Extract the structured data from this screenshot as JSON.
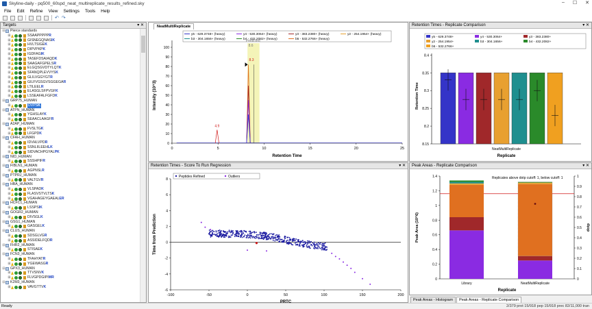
{
  "window": {
    "title": "Skyline-daily - pq500_60spd_neat_multireplicate_results_refined.sky",
    "min": "–",
    "max": "☐",
    "close": "✕"
  },
  "menu": [
    "File",
    "Edit",
    "Refine",
    "View",
    "Settings",
    "Tools",
    "Help"
  ],
  "targets": {
    "title": "Targets",
    "rows": [
      {
        "type": "protein",
        "name": "Pierce standards",
        "open": true
      },
      {
        "type": "pep",
        "seq": "SSAAPPPPP",
        "mod": "R"
      },
      {
        "type": "pep",
        "seq": "GISNEGQNAS",
        "mod": "IK"
      },
      {
        "type": "pep",
        "seq": "HVLTSIGE",
        "mod": "K"
      },
      {
        "type": "pep",
        "seq": "DIPVPKP",
        "mod": "K"
      },
      {
        "type": "pep",
        "seq": "IGDFAG",
        "mod": "IK"
      },
      {
        "type": "pep",
        "seq": "TASEFDSAIAQD",
        "mod": "K"
      },
      {
        "type": "pep",
        "seq": "SAAGAFGPELS",
        "mod": "R"
      },
      {
        "type": "pep",
        "seq": "ELGQSGVDTYLQT",
        "mod": "K"
      },
      {
        "type": "pep",
        "seq": "SFANQPLEVVYS",
        "mod": "K"
      },
      {
        "type": "pep",
        "seq": "GLILVGGYGT",
        "mod": "R"
      },
      {
        "type": "pep",
        "seq": "GILFVGSGVSGGEGA",
        "mod": "R"
      },
      {
        "type": "pep",
        "seq": "LTILEEL",
        "mod": "R"
      },
      {
        "type": "pep",
        "seq": "ELASGLSFPVGF",
        "mod": "K"
      },
      {
        "type": "pep",
        "seq": "LSSEAFALFGFD",
        "mod": "K"
      },
      {
        "type": "protein",
        "name": "GRP75_HUMAN",
        "open": true
      },
      {
        "type": "pep",
        "seq": "DVPS",
        "mod": "K",
        "sel": true
      },
      {
        "type": "protein",
        "name": "ATPN_HUMAN",
        "open": true
      },
      {
        "type": "pep",
        "seq": "YGHSLAY",
        "mod": "K"
      },
      {
        "type": "pep",
        "seq": "SEAACLAAGF",
        "mod": "R"
      },
      {
        "type": "protein",
        "name": "A2AP_HUMAN",
        "open": true
      },
      {
        "type": "pep",
        "seq": "FVSLTG",
        "mod": "K"
      },
      {
        "type": "pep",
        "seq": "LFGPD",
        "mod": "K"
      },
      {
        "type": "protein",
        "name": "CFAH_HUMAN",
        "open": true
      },
      {
        "type": "pep",
        "seq": "IDVHLVPD",
        "mod": "R"
      },
      {
        "type": "pep",
        "seq": "SSNLIILEEH",
        "mod": "LK"
      },
      {
        "type": "pep",
        "seq": "SIDVACHPGYAL",
        "mod": "PK"
      },
      {
        "type": "protein",
        "name": "NID_HUMAN",
        "open": true
      },
      {
        "type": "pep",
        "seq": "SSSHPIF",
        "mod": "R"
      },
      {
        "type": "protein",
        "name": "FIBLN1_HUMAN",
        "open": true
      },
      {
        "type": "pep",
        "seq": "AGPNSL",
        "mod": "R"
      },
      {
        "type": "protein",
        "name": "PTPRJ_HUMAN",
        "open": true
      },
      {
        "type": "pep",
        "seq": "VALTGV",
        "mod": "R"
      },
      {
        "type": "protein",
        "name": "HBA_HUMAN",
        "open": true
      },
      {
        "type": "pep",
        "seq": "VLSPAD",
        "mod": "K"
      },
      {
        "type": "pep",
        "seq": "FLASVSTVLTS",
        "mod": "K"
      },
      {
        "type": "pep",
        "seq": "VGAHAGEYGAEAL",
        "mod": "ER"
      },
      {
        "type": "protein",
        "name": "HCFC1_HUMAN",
        "open": true
      },
      {
        "type": "pep",
        "seq": "LSSPS",
        "mod": "IK"
      },
      {
        "type": "protein",
        "name": "GOGR2_HUMAN",
        "open": true
      },
      {
        "type": "pep",
        "seq": "DIVSGL",
        "mod": "K"
      },
      {
        "type": "protein",
        "name": "GSG1_HUMAN",
        "open": true
      },
      {
        "type": "pep",
        "seq": "GASGEL",
        "mod": "K"
      },
      {
        "type": "protein",
        "name": "CLUS_HUMAN",
        "open": true
      },
      {
        "type": "pep",
        "seq": "SDSGLVG",
        "mod": "R"
      },
      {
        "type": "pep",
        "seq": "ASSIDELFQD",
        "mod": "R"
      },
      {
        "type": "protein",
        "name": "FHR2_HUMAN",
        "open": true
      },
      {
        "type": "pep",
        "seq": "STISAE",
        "mod": "K"
      },
      {
        "type": "protein",
        "name": "FCN3_HUMAN",
        "open": true
      },
      {
        "type": "pep",
        "seq": "TFAHYAT",
        "mod": "R"
      },
      {
        "type": "pep",
        "seq": "YGEWASG",
        "mod": "R"
      },
      {
        "type": "protein",
        "name": "GPX3_HUMAN",
        "open": true
      },
      {
        "type": "pep",
        "seq": "TTVSNV",
        "mod": "K"
      },
      {
        "type": "pep",
        "seq": "FLVGPDGIPI",
        "mod": "MR"
      },
      {
        "type": "protein",
        "name": "K2M3_HUMAN",
        "open": true
      },
      {
        "type": "pep",
        "seq": "VAVGTTV",
        "mod": "K"
      }
    ]
  },
  "chromatogram": {
    "tab": "NeatMultiReplicate",
    "legend": [
      {
        "label": "y5 - 629.3748+ (heavy)",
        "color": "#3434c8"
      },
      {
        "label": "y4 - 530.3064+ (heavy)",
        "color": "#8a2be2"
      },
      {
        "label": "y3 - 383.2380+ (heavy)",
        "color": "#a0282a"
      },
      {
        "label": "y2 - 254.1954+ (heavy)",
        "color": "#e8a030"
      },
      {
        "label": "b3 - 304.1656+ (heavy)",
        "color": "#1f8f8f"
      },
      {
        "label": "b4 - 432.2082+ (heavy)",
        "color": "#2a8a2a"
      },
      {
        "label": "b5 - 532.2766+ (heavy)",
        "color": "#e07020"
      }
    ],
    "ylabel": "Intensity (10^3)",
    "xlabel": "Retention Time",
    "predicted_label": "Predicted",
    "predicted_value": "8.6",
    "peak_labels": [
      "4.9",
      "8.3"
    ],
    "xticks": [
      "0",
      "5",
      "10",
      "15",
      "20",
      "25"
    ],
    "yticks": [
      "0",
      "10",
      "20",
      "30",
      "40",
      "50",
      "60",
      "70",
      "80",
      "90",
      "100"
    ]
  },
  "rt_replicate": {
    "title": "Retention Times - Replicate Comparison",
    "legend": [
      {
        "label": "y5 - 629.3748+",
        "color": "#3434c8"
      },
      {
        "label": "y4 - 530.3064+",
        "color": "#8a2be2"
      },
      {
        "label": "y3 - 383.2380+",
        "color": "#a0282a"
      },
      {
        "label": "y2 - 254.1954+",
        "color": "#e8a030"
      },
      {
        "label": "b3 - 304.1656+",
        "color": "#1f8f8f"
      },
      {
        "label": "b4 - 432.2082+",
        "color": "#2a8a2a"
      },
      {
        "label": "b5 - 532.2766+",
        "color": "#f0a020"
      }
    ],
    "ylabel": "Retention Time",
    "xlabel": "Replicate",
    "category": "NeatMultiReplicate",
    "yticks": [
      "8.15",
      "8.2",
      "8.25",
      "8.3",
      "8.35",
      "8.4"
    ]
  },
  "regression": {
    "title": "Retention Times - Score To Run Regression",
    "legend": [
      {
        "label": "Peptides Refined",
        "color": "#1a1aa0"
      },
      {
        "label": "Outliers",
        "color": "#8a2be2"
      }
    ],
    "ylabel": "Time from Prediction",
    "xlabel": "PRTC",
    "xticks": [
      "-100",
      "-50",
      "0",
      "50",
      "100",
      "150",
      "200"
    ],
    "yticks": [
      "-6",
      "-4",
      "-2",
      "0",
      "2",
      "4",
      "6",
      "8"
    ]
  },
  "peak_areas": {
    "title": "Peak Areas - Replicate Comparison",
    "annotation": "Replicates above dotp cutoff: 1, below cutoff: 1",
    "ylabel": "Peak Area (10^6)",
    "ylabel2": "dotp",
    "xlabel": "Replicate",
    "categories": [
      "Library",
      "NeatMultiReplicate"
    ],
    "yticks": [
      "0",
      "0.2",
      "0.4",
      "0.6",
      "0.8",
      "1",
      "1.2",
      "1.4"
    ],
    "y2ticks": [
      "0",
      "0.1",
      "0.2",
      "0.3",
      "0.4",
      "0.5",
      "0.6",
      "0.7",
      "0.8",
      "0.9",
      "1"
    ]
  },
  "bottom_tabs": [
    "Peak Areas - Histogram",
    "Peak Areas - Replicate Comparison"
  ],
  "status": {
    "left": "Ready",
    "right": "2/379 prot   15/918 pep   15/918 prec   82/11,000 tran"
  }
}
